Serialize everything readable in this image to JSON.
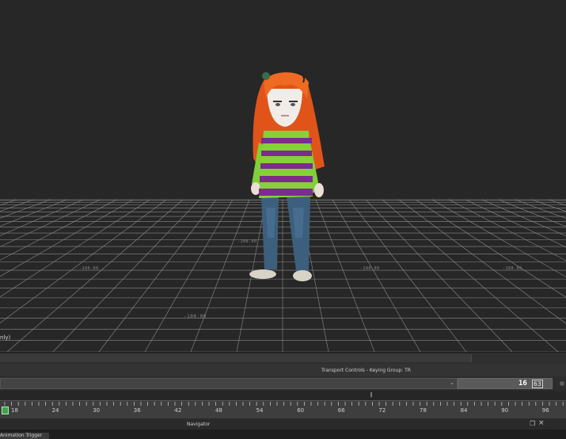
{
  "viewport": {
    "status_text": "nly)",
    "grid_labels": {
      "far_left": "-100.00",
      "far_center": "-100.00",
      "mid_right": "-100.00",
      "right": "-100.00",
      "near": "-100.00"
    }
  },
  "transport": {
    "title": "Transport Controls - Keying Group: TR",
    "current_frame": "16",
    "end_frame": "63"
  },
  "timeline": {
    "tick_labels": [
      "18",
      "24",
      "30",
      "36",
      "42",
      "48",
      "54",
      "60",
      "66",
      "72",
      "78",
      "84",
      "90",
      "96"
    ]
  },
  "navigator": {
    "title": "Navigator"
  },
  "bottom_tab": {
    "label": "Animation Trigger"
  },
  "colors": {
    "viewport_bg": "#272727",
    "playhead": "#3aa54a"
  }
}
